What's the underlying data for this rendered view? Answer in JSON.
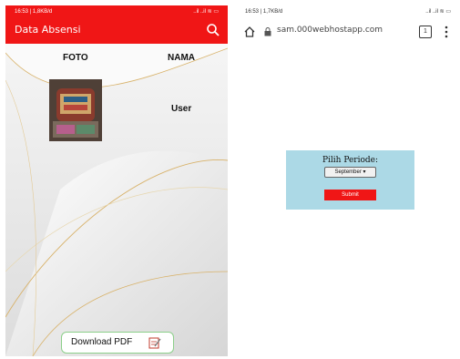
{
  "left_app": {
    "status_bar": {
      "time": "16:53 | 1,8KB/d",
      "icons": "..il ..il ≋ ▭"
    },
    "app_bar": {
      "title": "Data Absensi",
      "search_icon": "search-icon"
    },
    "table": {
      "headers": [
        "FOTO",
        "NAMA"
      ],
      "rows": [
        {
          "nama": "User"
        }
      ]
    },
    "download_button": {
      "label": "Download PDF",
      "icon": "pdf-edit-icon"
    },
    "colors": {
      "primary": "#f01616",
      "button_border": "#8ccf8a"
    }
  },
  "right_browser": {
    "status_bar": {
      "time": "16:53 | 1,7KB/d",
      "icons": "..il ..il ≋ ▭"
    },
    "url_bar": {
      "url": "sam.000webhostapp.com",
      "tabs_count": "1"
    },
    "form": {
      "label": "Pilih Periode:",
      "select_value": "September ▾",
      "submit_label": "Submit"
    },
    "colors": {
      "form_bg": "#acd9e6",
      "submit_bg": "#f01616"
    }
  }
}
